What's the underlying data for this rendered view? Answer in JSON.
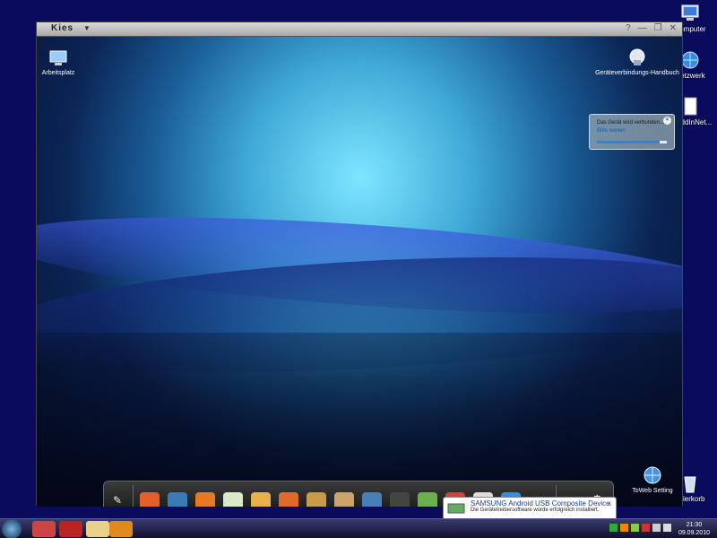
{
  "desktop": {
    "icons": [
      {
        "label": "Computer"
      },
      {
        "label": "Netzwerk"
      },
      {
        "label": "okAddInNet..."
      },
      {
        "label": "spierkorb"
      }
    ]
  },
  "kies": {
    "title": "Kies",
    "controls": {
      "help": "?",
      "minimize": "—",
      "maximize": "❐",
      "close": "✕"
    },
    "icons": {
      "arbeitsplatz": "Arbeitsplatz",
      "handbuch": "Geräteverbindungs-Handbuch",
      "toweb": "ToWeb Setting"
    },
    "connection": {
      "status": "Das Gerät wird verbunden...",
      "link": "Bitte warten",
      "progress": 0.9
    },
    "dock_apps": [
      "dock-settings-icon",
      "contacts-icon",
      "map-icon",
      "phone-icon",
      "calendar-icon",
      "email-icon",
      "memo-icon",
      "gallery-icon",
      "photo-icon",
      "music-icon",
      "video-icon",
      "game-icon",
      "shop-icon",
      "cd-icon",
      "browser-icon"
    ]
  },
  "taskbar": {
    "time": "21:30",
    "date": "09.09.2010"
  },
  "balloon": {
    "title": "SAMSUNG Android USB Composite Device",
    "message": "Die Gerätetreibersoftware wurde erfolgreich installiert.",
    "close": "x"
  }
}
